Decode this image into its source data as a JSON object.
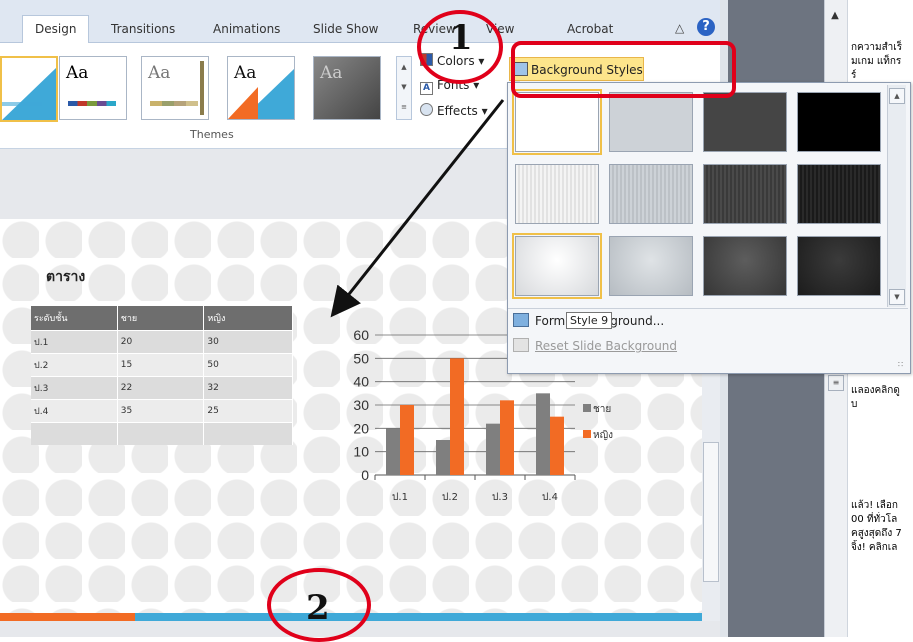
{
  "ribbon": {
    "tabs": [
      {
        "label": "Design",
        "active": true
      },
      {
        "label": "Transitions"
      },
      {
        "label": "Animations"
      },
      {
        "label": "Slide Show"
      },
      {
        "label": "Review"
      },
      {
        "label": "View"
      },
      {
        "label": "Acrobat"
      }
    ],
    "icons": {
      "collapse": "chevron-up-icon",
      "help": "help-icon"
    },
    "help_label": "?",
    "themes": {
      "group_label": "Themes",
      "sample_text": "Aa",
      "options": {
        "colors": "Colors",
        "fonts": "Fonts",
        "effects": "Effects"
      }
    },
    "background_styles_label": "Background Styles"
  },
  "gallery": {
    "format_background_label": "Format Background...",
    "reset_background_label": "Reset Slide Background",
    "tooltip": "Style 9"
  },
  "slide": {
    "title": "ตาราง",
    "table": {
      "headers": [
        "ระดับชั้น",
        "ชาย",
        "หญิง"
      ],
      "rows": [
        [
          "ป.1",
          "20",
          "30"
        ],
        [
          "ป.2",
          "15",
          "50"
        ],
        [
          "ป.3",
          "22",
          "32"
        ],
        [
          "ป.4",
          "35",
          "25"
        ],
        [
          "",
          "",
          ""
        ]
      ]
    }
  },
  "chart_data": {
    "type": "bar",
    "categories": [
      "ป.1",
      "ป.2",
      "ป.3",
      "ป.4"
    ],
    "series": [
      {
        "name": "ชาย",
        "values": [
          20,
          15,
          22,
          35
        ],
        "color": "#7f7f7f"
      },
      {
        "name": "หญิง",
        "values": [
          30,
          50,
          32,
          25
        ],
        "color": "#f26b24"
      }
    ],
    "ylim": [
      0,
      60
    ],
    "yticks": [
      0,
      10,
      20,
      30,
      40,
      50,
      60
    ],
    "grid": true,
    "legend": "right",
    "title": "",
    "xlabel": "",
    "ylabel": ""
  },
  "task_pane": {
    "lines": [
      "กความสำเร็",
      "มเกม แท็กร",
      "ร์",
      "แลองคลิกดู",
      "บ",
      "แล้ว! เลือก",
      "00 ที่ทั่วโล",
      "คสูงสุดถึง 7",
      "จิ้ง! คลิกเล"
    ]
  },
  "annotations": {
    "step1": "1",
    "step2": "2"
  },
  "colors": {
    "annotation_red": "#e0001a",
    "accent_orange": "#f26b24",
    "accent_blue": "#3fa9d8",
    "highlight": "#fde58b"
  }
}
